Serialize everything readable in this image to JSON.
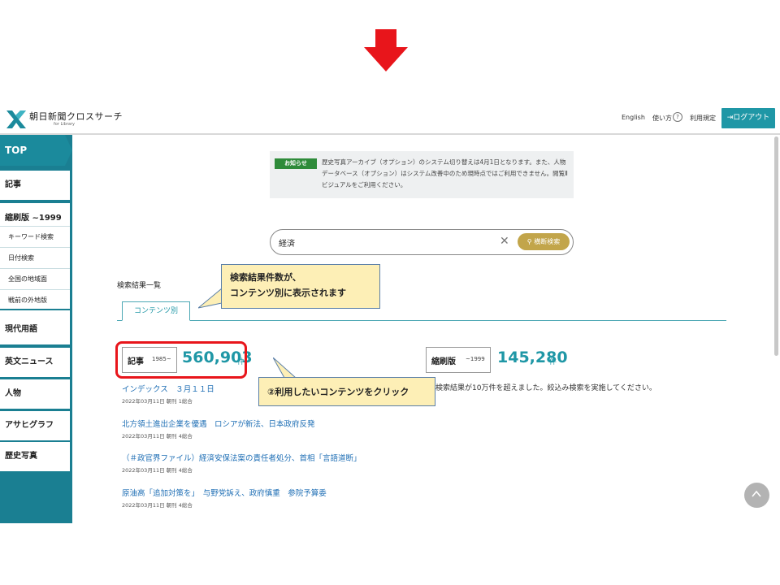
{
  "header": {
    "brand": "朝日新聞クロスサーチ",
    "brand_sub": "for Library",
    "links": [
      "English",
      "使い方",
      "利用規定"
    ],
    "help_mark": "?",
    "logout": "ログアウト"
  },
  "sidebar": {
    "top": "TOP",
    "items": [
      "記事",
      "縮刷版 ~1999",
      "現代用語",
      "英文ニュース",
      "人物",
      "アサヒグラフ",
      "歴史写真"
    ],
    "sub_items": [
      "キーワード検索",
      "日付検索",
      "全国の地域面",
      "戦前の外地版"
    ]
  },
  "notice": {
    "badge": "お知らせ",
    "text": "歴史写真アーカイブ（オプション）のシステム切り替えは4月1日となります。また、人物データベース（オプション）はシステム改善中のため現時点ではご利用できません。閲覧Ⅱビジュアルをご利用ください。"
  },
  "search": {
    "value": "経済",
    "button": "横断検索"
  },
  "results": {
    "title": "検索結果一覧",
    "tab": "コンテンツ別",
    "kiji": {
      "label": "記事",
      "range": "1985~",
      "count": "560,903",
      "unit": "件"
    },
    "shuku": {
      "label": "縮刷版",
      "range": "~1999",
      "count": "145,280",
      "unit": "件"
    },
    "shuku_message": "検索結果が10万件を超えました。絞込み検索を実施してください。"
  },
  "callouts": {
    "first_line1": "検索結果件数が、",
    "first_line2": "コンテンツ別に表示されます",
    "second": "②利用したいコンテンツをクリック"
  },
  "articles": [
    {
      "title": "インデックス　３月１１日",
      "meta": "2022年03月11日 朝刊 1総合"
    },
    {
      "title": "北方領土進出企業を優遇　ロシアが新法、日本政府反発",
      "meta": "2022年03月11日 朝刊 4総合"
    },
    {
      "title": "（＃政官界ファイル）経済安保法案の責任者処分、首相「言語道断」",
      "meta": "2022年03月11日 朝刊 4総合"
    },
    {
      "title": "原油高「追加対策を」　与野党訴え、政府慎重　参院予算委",
      "meta": "2022年03月11日 朝刊 4総合"
    }
  ],
  "colors": {
    "accent": "#1f97a6",
    "sidebar": "#1a7f92",
    "highlight": "#e8151b",
    "callout": "#fdefb6"
  }
}
